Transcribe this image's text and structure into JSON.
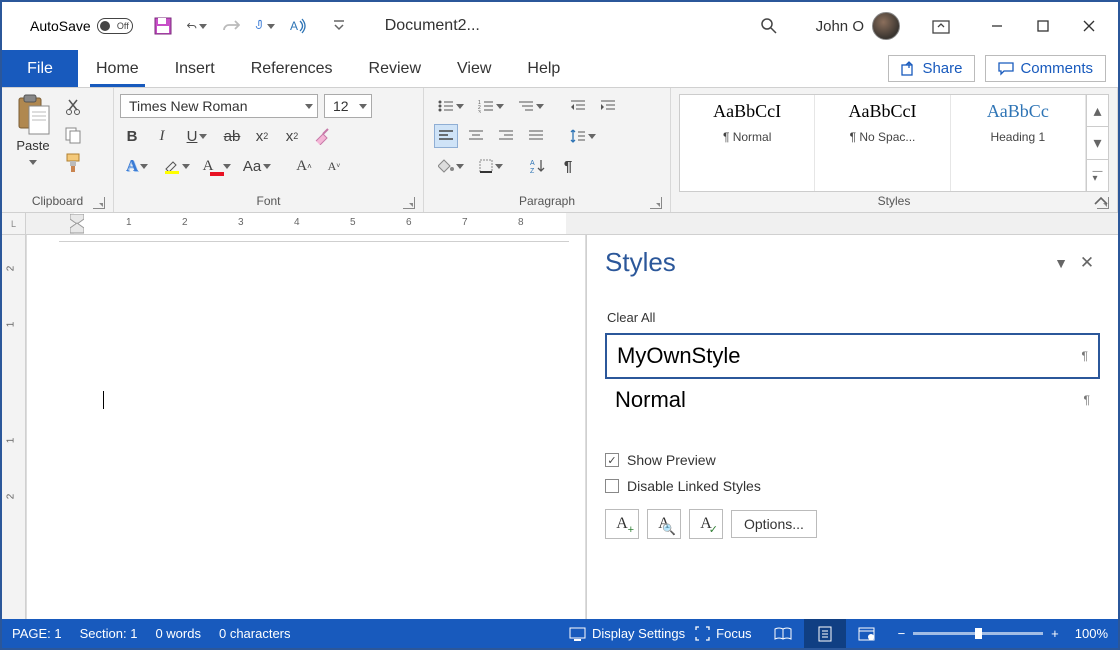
{
  "titlebar": {
    "autosave_label": "AutoSave",
    "autosave_state": "Off",
    "doc_title": "Document2...",
    "user_name": "John O"
  },
  "tabs": {
    "file": "File",
    "items": [
      "Home",
      "Insert",
      "References",
      "Review",
      "View",
      "Help"
    ],
    "active": "Home",
    "share": "Share",
    "comments": "Comments"
  },
  "ribbon": {
    "clipboard": {
      "paste": "Paste",
      "label": "Clipboard"
    },
    "font": {
      "name": "Times New Roman",
      "size": "12",
      "label": "Font"
    },
    "paragraph": {
      "label": "Paragraph"
    },
    "styles": {
      "label": "Styles",
      "items": [
        {
          "preview": "AaBbCcI",
          "name": "¶ Normal"
        },
        {
          "preview": "AaBbCcI",
          "name": "¶ No Spac..."
        },
        {
          "preview": "AaBbCc",
          "name": "Heading 1",
          "heading": true
        }
      ]
    }
  },
  "ruler": {
    "h": [
      "1",
      "2",
      "3",
      "4",
      "5",
      "6",
      "7",
      "8"
    ],
    "v": [
      "2",
      "1",
      "1",
      "2"
    ]
  },
  "styles_pane": {
    "title": "Styles",
    "clear": "Clear All",
    "items": [
      {
        "name": "MyOwnStyle",
        "selected": true
      },
      {
        "name": "Normal",
        "selected": false
      }
    ],
    "show_preview": "Show Preview",
    "show_preview_checked": true,
    "disable_linked": "Disable Linked Styles",
    "disable_linked_checked": false,
    "options": "Options..."
  },
  "statusbar": {
    "page": "PAGE: 1",
    "section": "Section: 1",
    "words": "0 words",
    "chars": "0 characters",
    "display_settings": "Display Settings",
    "focus": "Focus",
    "zoom": "100%"
  }
}
